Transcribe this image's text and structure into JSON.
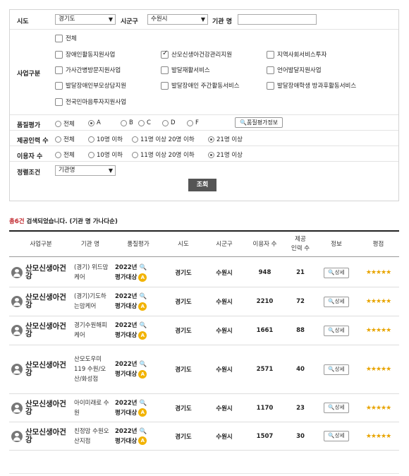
{
  "filter": {
    "sido_label": "시도",
    "sido_value": "경기도",
    "sigungu_label": "시군구",
    "sigungu_value": "수원시",
    "org_label": "기관 명",
    "org_value": "",
    "business_label": "사업구분",
    "business_options": [
      {
        "label": "전체",
        "checked": false
      },
      {
        "label": "장애인활동지원사업",
        "checked": false
      },
      {
        "label": "산모신생아건강관리지원",
        "checked": true
      },
      {
        "label": "지역사회서비스투자",
        "checked": false
      },
      {
        "label": "가사간병방문지원사업",
        "checked": false
      },
      {
        "label": "발달재활서비스",
        "checked": false
      },
      {
        "label": "언어발달지원사업",
        "checked": false
      },
      {
        "label": "발달장애인부모상담지원",
        "checked": false
      },
      {
        "label": "발달장애인 주간활동서비스",
        "checked": false
      },
      {
        "label": "발달장애학생 방과후활동서비스",
        "checked": false
      },
      {
        "label": "전국민마음투자지원사업",
        "checked": false
      }
    ],
    "quality_label": "품질평가",
    "quality_options": [
      "전체",
      "A",
      "B",
      "C",
      "D",
      "F"
    ],
    "quality_selected": 1,
    "quality_info_button": "품질평가정보",
    "staff_label": "제공인력 수",
    "staff_options": [
      "전체",
      "10명 이하",
      "11명 이상 20명 이하",
      "21명 이상"
    ],
    "staff_selected": 3,
    "users_label": "이용자 수",
    "users_options": [
      "전체",
      "10명 이하",
      "11명 이상 20명 이하",
      "21명 이상"
    ],
    "users_selected": 3,
    "sort_label": "정렬조건",
    "sort_value": "기관명",
    "search_button": "조회"
  },
  "result": {
    "count_text": "총6건",
    "suffix_text": " 검색되었습니다. (기관 명 가나다순)"
  },
  "table": {
    "headers": [
      "사업구분",
      "기관 명",
      "품질평가",
      "시도",
      "시군구",
      "이용자 수",
      "제공\n인력 수",
      "정보",
      "평점"
    ],
    "detail_label": "상세",
    "rows": [
      {
        "type": "산모신생아건강",
        "org": "(경기) 위드맘케어",
        "year": "2022년",
        "eval": "평가대상",
        "sido": "경기도",
        "sigungu": "수원시",
        "users": "948",
        "staff": "21",
        "stars": "★★★★★"
      },
      {
        "type": "산모신생아건강",
        "org": "(경기)기도하는맘케어",
        "year": "2022년",
        "eval": "평가대상",
        "sido": "경기도",
        "sigungu": "수원시",
        "users": "2210",
        "staff": "72",
        "stars": "★★★★★"
      },
      {
        "type": "산모신생아건강",
        "org": "경기수원해피케어",
        "year": "2022년",
        "eval": "평가대상",
        "sido": "경기도",
        "sigungu": "수원시",
        "users": "1661",
        "staff": "88",
        "stars": "★★★★★"
      },
      {
        "type": "산모신생아건강",
        "org": "산모도우미119 수원/오산/화성점",
        "year": "2022년",
        "eval": "평가대상",
        "sido": "경기도",
        "sigungu": "수원시",
        "users": "2571",
        "staff": "40",
        "stars": "★★★★★"
      },
      {
        "type": "산모신생아건강",
        "org": "아이미래로 수원",
        "year": "2022년",
        "eval": "평가대상",
        "sido": "경기도",
        "sigungu": "수원시",
        "users": "1170",
        "staff": "23",
        "stars": "★★★★★"
      },
      {
        "type": "산모신생아건강",
        "org": "친정맘 수원오산지점",
        "year": "2022년",
        "eval": "평가대상",
        "sido": "경기도",
        "sigungu": "수원시",
        "users": "1507",
        "staff": "30",
        "stars": "★★★★★"
      }
    ]
  }
}
